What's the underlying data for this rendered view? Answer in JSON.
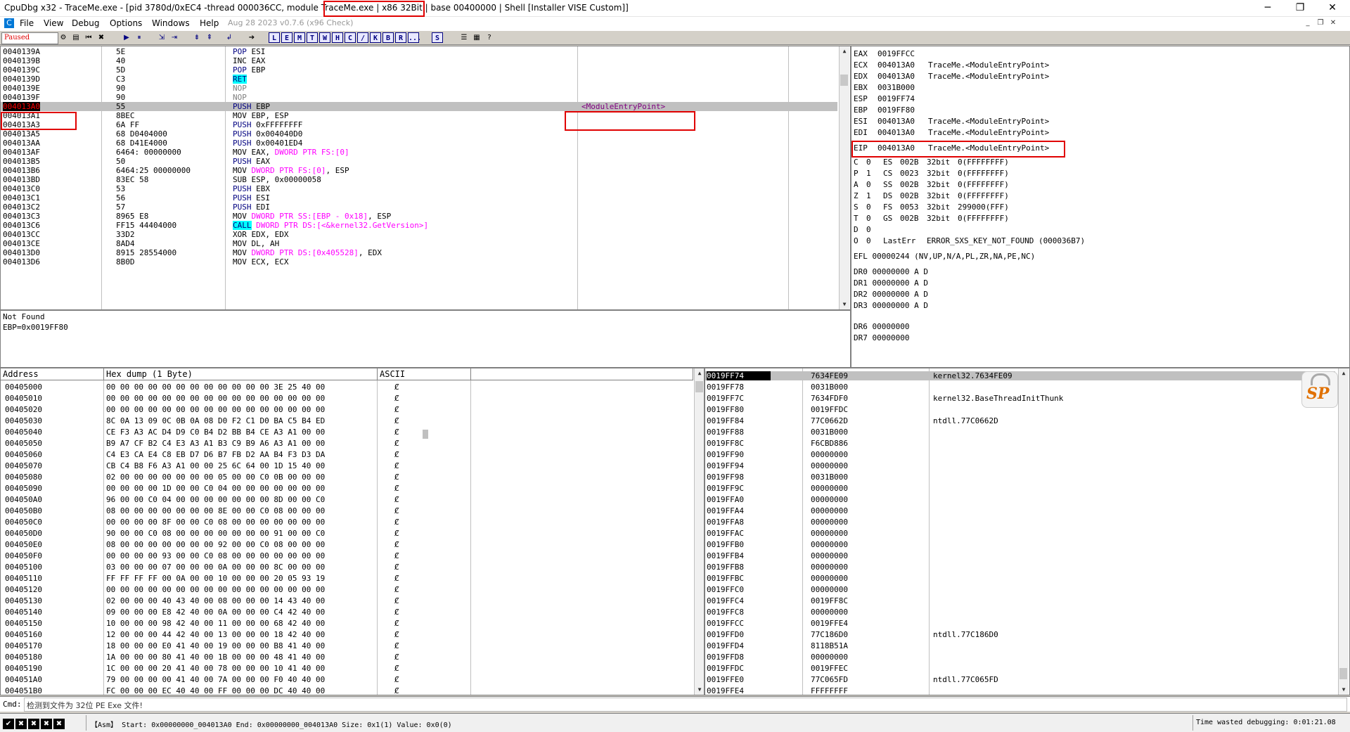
{
  "window": {
    "title": "CpuDbg x32 - TraceMe.exe - [pid 3780d/0xEC4 -thread 000036CC, module TraceMe.exe | x86 32Bit | base 00400000 | Shell [Installer VISE Custom]]",
    "minimize": "─",
    "maximize": "❐",
    "close": "✕"
  },
  "menu": {
    "items": [
      "File",
      "View",
      "Debug",
      "Options",
      "Windows",
      "Help"
    ],
    "build_info": "Aug 28 2023  v0.7.6 (x96 Check)"
  },
  "toolbar": {
    "state": "Paused",
    "letter_buttons": [
      "L",
      "E",
      "M",
      "T",
      "W",
      "H",
      "C",
      "/",
      "K",
      "B",
      "R",
      "...",
      "S"
    ]
  },
  "disasm": {
    "rows": [
      {
        "addr": "0040139A",
        "bytes": "5E",
        "op": "POP",
        "args": "ESI",
        "cls": "kw-push"
      },
      {
        "addr": "0040139B",
        "bytes": "40",
        "op": "INC",
        "args": "EAX",
        "cls": "kw"
      },
      {
        "addr": "0040139C",
        "bytes": "5D",
        "op": "POP",
        "args": "EBP",
        "cls": "kw-push"
      },
      {
        "addr": "0040139D",
        "bytes": "C3",
        "op": "RET",
        "args": "",
        "cls": "kw-ret"
      },
      {
        "addr": "0040139E",
        "bytes": "90",
        "op": "NOP",
        "args": "",
        "cls": "kw-nop"
      },
      {
        "addr": "0040139F",
        "bytes": "90",
        "op": "NOP",
        "args": "",
        "cls": "kw-nop"
      },
      {
        "addr": "004013A0",
        "bytes": "55",
        "op": "PUSH",
        "args": "EBP",
        "cls": "kw-push",
        "hl": true,
        "comment": "<ModuleEntryPoint>"
      },
      {
        "addr": "004013A1",
        "bytes": "8BEC",
        "op": "MOV",
        "args": "EBP,  ESP",
        "cls": "kw-mov"
      },
      {
        "addr": "004013A3",
        "bytes": "6A FF",
        "op": "PUSH",
        "args": "0xFFFFFFFF",
        "cls": "kw-push"
      },
      {
        "addr": "004013A5",
        "bytes": "68 D0404000",
        "op": "PUSH",
        "args": "0x004040D0",
        "cls": "kw-push"
      },
      {
        "addr": "004013AA",
        "bytes": "68 D41E4000",
        "op": "PUSH",
        "args": "0x00401ED4",
        "cls": "kw-push"
      },
      {
        "addr": "004013AF",
        "bytes": "6464: 00000000",
        "op": "MOV",
        "args": "EAX,  ",
        "mem": "DWORD PTR FS:[0]",
        "cls": "kw-mov"
      },
      {
        "addr": "004013B5",
        "bytes": "50",
        "op": "PUSH",
        "args": "EAX",
        "cls": "kw-push"
      },
      {
        "addr": "004013B6",
        "bytes": "6464:25 00000000",
        "op": "MOV",
        "args": "",
        "mem": "DWORD PTR FS:[0]",
        "tail": ",  ESP",
        "cls": "kw-mov"
      },
      {
        "addr": "004013BD",
        "bytes": "83EC 58",
        "op": "SUB",
        "args": "ESP,  0x00000058",
        "cls": "kw"
      },
      {
        "addr": "004013C0",
        "bytes": "53",
        "op": "PUSH",
        "args": "EBX",
        "cls": "kw-push"
      },
      {
        "addr": "004013C1",
        "bytes": "56",
        "op": "PUSH",
        "args": "ESI",
        "cls": "kw-push"
      },
      {
        "addr": "004013C2",
        "bytes": "57",
        "op": "PUSH",
        "args": "EDI",
        "cls": "kw-push"
      },
      {
        "addr": "004013C3",
        "bytes": "8965 E8",
        "op": "MOV",
        "args": "",
        "mem": "DWORD PTR SS:[EBP - 0x18]",
        "tail": ",  ESP",
        "cls": "kw-mov"
      },
      {
        "addr": "004013C6",
        "bytes": "FF15 44404000",
        "op": "CALL",
        "args": "",
        "mem": "DWORD PTR DS:[<&kernel32.GetVersion>]",
        "cls": "kw-call"
      },
      {
        "addr": "004013CC",
        "bytes": "33D2",
        "op": "XOR",
        "args": "EDX,  EDX",
        "cls": "kw"
      },
      {
        "addr": "004013CE",
        "bytes": "8AD4",
        "op": "MOV",
        "args": "DL,  AH",
        "cls": "kw-mov"
      },
      {
        "addr": "004013D0",
        "bytes": "8915 28554000",
        "op": "MOV",
        "args": "",
        "mem": "DWORD PTR DS:[0x405528]",
        "tail": ",  EDX",
        "cls": "kw-mov"
      },
      {
        "addr": "004013D6",
        "bytes": "8B0D",
        "op": "MOV",
        "args": "ECX,  ECX",
        "cls": "kw-mov"
      }
    ]
  },
  "info": {
    "lines": [
      "Not Found",
      "EBP=0x0019FF80"
    ]
  },
  "registers": {
    "gprs": [
      {
        "name": "EAX",
        "value": "0019FFCC",
        "note": ""
      },
      {
        "name": "ECX",
        "value": "004013A0",
        "note": "TraceMe.<ModuleEntryPoint>"
      },
      {
        "name": "EDX",
        "value": "004013A0",
        "note": "TraceMe.<ModuleEntryPoint>"
      },
      {
        "name": "EBX",
        "value": "0031B000",
        "note": ""
      },
      {
        "name": "ESP",
        "value": "0019FF74",
        "note": ""
      },
      {
        "name": "EBP",
        "value": "0019FF80",
        "note": ""
      },
      {
        "name": "ESI",
        "value": "004013A0",
        "note": "TraceMe.<ModuleEntryPoint>"
      },
      {
        "name": "EDI",
        "value": "004013A0",
        "note": "TraceMe.<ModuleEntryPoint>"
      }
    ],
    "eip": {
      "name": "EIP",
      "value": "004013A0",
      "note": "TraceMe.<ModuleEntryPoint>"
    },
    "flags": [
      {
        "f": "C",
        "v": "0",
        "seg": "ES",
        "sel": "002B",
        "bits": "32bit",
        "range": "0(FFFFFFFF)"
      },
      {
        "f": "P",
        "v": "1",
        "seg": "CS",
        "sel": "0023",
        "bits": "32bit",
        "range": "0(FFFFFFFF)"
      },
      {
        "f": "A",
        "v": "0",
        "seg": "SS",
        "sel": "002B",
        "bits": "32bit",
        "range": "0(FFFFFFFF)"
      },
      {
        "f": "Z",
        "v": "1",
        "seg": "DS",
        "sel": "002B",
        "bits": "32bit",
        "range": "0(FFFFFFFF)"
      },
      {
        "f": "S",
        "v": "0",
        "seg": "FS",
        "sel": "0053",
        "bits": "32bit",
        "range": "299000(FFF)"
      },
      {
        "f": "T",
        "v": "0",
        "seg": "GS",
        "sel": "002B",
        "bits": "32bit",
        "range": "0(FFFFFFFF)"
      },
      {
        "f": "D",
        "v": "0",
        "seg": "",
        "sel": "",
        "bits": "",
        "range": ""
      },
      {
        "f": "O",
        "v": "0",
        "seg": "LastErr",
        "sel": "ERROR_SXS_KEY_NOT_FOUND (000036B7)",
        "bits": "",
        "range": ""
      }
    ],
    "efl": "EFL  00000244 (NV,UP,N/A,PL,ZR,NA,PE,NC)",
    "dr": [
      "DR0  00000000 A D",
      "DR1  00000000 A D",
      "DR2  00000000 A D",
      "DR3  00000000 A D",
      "DR6  00000000",
      "DR7  00000000"
    ]
  },
  "dump": {
    "headers": [
      "Address",
      "Hex dump (1 Byte)",
      "ASCII"
    ],
    "rows": [
      {
        "addr": "00405000",
        "hex": "00 00 00 00 00 00 00 00 00 00 00 00 3E 25 40 00"
      },
      {
        "addr": "00405010",
        "hex": "00 00 00 00 00 00 00 00 00 00 00 00 00 00 00 00"
      },
      {
        "addr": "00405020",
        "hex": "00 00 00 00 00 00 00 00 00 00 00 00 00 00 00 00"
      },
      {
        "addr": "00405030",
        "hex": "8C 0A 13 09 0C 0B 0A 08 D0 F2 C1 D0 BA C5 B4 ED"
      },
      {
        "addr": "00405040",
        "hex": "CE F3 A3 AC D4 D9 C0 B4 D2 BB B4 CE A3 A1 00 00"
      },
      {
        "addr": "00405050",
        "hex": "B9 A7 CF B2 C4 E3 A3 A1 B3 C9 B9 A6 A3 A1 00 00"
      },
      {
        "addr": "00405060",
        "hex": "C4 E3 CA E4 C8 EB D7 D6 B7 FB D2 AA B4 F3 D3 DA"
      },
      {
        "addr": "00405070",
        "hex": "CB C4 B8 F6 A3 A1 00 00 25 6C 64 00 1D 15 40 00"
      },
      {
        "addr": "00405080",
        "hex": "02 00 00 00 00 00 00 00 05 00 00 C0 0B 00 00 00"
      },
      {
        "addr": "00405090",
        "hex": "00 00 00 00 1D 00 00 C0 04 00 00 00 00 00 00 00"
      },
      {
        "addr": "004050A0",
        "hex": "96 00 00 C0 04 00 00 00 00 00 00 00 8D 00 00 C0"
      },
      {
        "addr": "004050B0",
        "hex": "08 00 00 00 00 00 00 00 8E 00 00 C0 08 00 00 00"
      },
      {
        "addr": "004050C0",
        "hex": "00 00 00 00 8F 00 00 C0 08 00 00 00 00 00 00 00"
      },
      {
        "addr": "004050D0",
        "hex": "90 00 00 C0 08 00 00 00 00 00 00 00 91 00 00 C0"
      },
      {
        "addr": "004050E0",
        "hex": "08 00 00 00 00 00 00 00 92 00 00 C0 08 00 00 00"
      },
      {
        "addr": "004050F0",
        "hex": "00 00 00 00 93 00 00 C0 08 00 00 00 00 00 00 00"
      },
      {
        "addr": "00405100",
        "hex": "03 00 00 00 07 00 00 00 0A 00 00 00 8C 00 00 00"
      },
      {
        "addr": "00405110",
        "hex": "FF FF FF FF 00 0A 00 00 10 00 00 00 20 05 93 19"
      },
      {
        "addr": "00405120",
        "hex": "00 00 00 00 00 00 00 00 00 00 00 00 00 00 00 00"
      },
      {
        "addr": "00405130",
        "hex": "02 00 00 00 40 43 40 00 08 00 00 00 14 43 40 00"
      },
      {
        "addr": "00405140",
        "hex": "09 00 00 00 E8 42 40 00 0A 00 00 00 C4 42 40 00"
      },
      {
        "addr": "00405150",
        "hex": "10 00 00 00 98 42 40 00 11 00 00 00 68 42 40 00"
      },
      {
        "addr": "00405160",
        "hex": "12 00 00 00 44 42 40 00 13 00 00 00 18 42 40 00"
      },
      {
        "addr": "00405170",
        "hex": "18 00 00 00 E0 41 40 00 19 00 00 00 B8 41 40 00"
      },
      {
        "addr": "00405180",
        "hex": "1A 00 00 00 80 41 40 00 1B 00 00 00 48 41 40 00"
      },
      {
        "addr": "00405190",
        "hex": "1C 00 00 00 20 41 40 00 78 00 00 00 10 41 40 00"
      },
      {
        "addr": "004051A0",
        "hex": "79 00 00 00 00 41 40 00 7A 00 00 00 F0 40 40 00"
      },
      {
        "addr": "004051B0",
        "hex": "FC 00 00 00 EC 40 40 00 FF 00 00 00 DC 40 40 00"
      }
    ],
    "ascii_glyph": "Ȼ"
  },
  "stack": {
    "rows": [
      {
        "addr": "0019FF74",
        "val": "7634FE09",
        "cmt": "kernel32.7634FE09",
        "sel": true
      },
      {
        "addr": "0019FF78",
        "val": "0031B000",
        "cmt": ""
      },
      {
        "addr": "0019FF7C",
        "val": "7634FDF0",
        "cmt": "kernel32.BaseThreadInitThunk"
      },
      {
        "addr": "0019FF80",
        "val": "0019FFDC",
        "cmt": ""
      },
      {
        "addr": "0019FF84",
        "val": "77C0662D",
        "cmt": "ntdll.77C0662D"
      },
      {
        "addr": "0019FF88",
        "val": "0031B000",
        "cmt": ""
      },
      {
        "addr": "0019FF8C",
        "val": "F6CBD886",
        "cmt": ""
      },
      {
        "addr": "0019FF90",
        "val": "00000000",
        "cmt": ""
      },
      {
        "addr": "0019FF94",
        "val": "00000000",
        "cmt": ""
      },
      {
        "addr": "0019FF98",
        "val": "0031B000",
        "cmt": ""
      },
      {
        "addr": "0019FF9C",
        "val": "00000000",
        "cmt": ""
      },
      {
        "addr": "0019FFA0",
        "val": "00000000",
        "cmt": ""
      },
      {
        "addr": "0019FFA4",
        "val": "00000000",
        "cmt": ""
      },
      {
        "addr": "0019FFA8",
        "val": "00000000",
        "cmt": ""
      },
      {
        "addr": "0019FFAC",
        "val": "00000000",
        "cmt": ""
      },
      {
        "addr": "0019FFB0",
        "val": "00000000",
        "cmt": ""
      },
      {
        "addr": "0019FFB4",
        "val": "00000000",
        "cmt": ""
      },
      {
        "addr": "0019FFB8",
        "val": "00000000",
        "cmt": ""
      },
      {
        "addr": "0019FFBC",
        "val": "00000000",
        "cmt": ""
      },
      {
        "addr": "0019FFC0",
        "val": "00000000",
        "cmt": ""
      },
      {
        "addr": "0019FFC4",
        "val": "0019FF8C",
        "cmt": ""
      },
      {
        "addr": "0019FFC8",
        "val": "00000000",
        "cmt": ""
      },
      {
        "addr": "0019FFCC",
        "val": "0019FFE4",
        "cmt": ""
      },
      {
        "addr": "0019FFD0",
        "val": "77C186D0",
        "cmt": "ntdll.77C186D0"
      },
      {
        "addr": "0019FFD4",
        "val": "8118B51A",
        "cmt": ""
      },
      {
        "addr": "0019FFD8",
        "val": "00000000",
        "cmt": ""
      },
      {
        "addr": "0019FFDC",
        "val": "0019FFEC",
        "cmt": ""
      },
      {
        "addr": "0019FFE0",
        "val": "77C065FD",
        "cmt": "ntdll.77C065FD"
      },
      {
        "addr": "0019FFE4",
        "val": "FFFFFFFF",
        "cmt": ""
      }
    ],
    "logo": "SP"
  },
  "command": {
    "label": "Cmd:",
    "value": "检测到文件为 32位 PE Exe 文件!"
  },
  "status": {
    "asm": "【Asm】 Start: 0x00000000_004013A0 End: 0x00000000_004013A0 Size: 0x1(1) Value: 0x0(0)",
    "time": "Time wasted debugging: 0:01:21.08"
  },
  "colors": {
    "accent": "#e00000",
    "selection": "#000000",
    "highlight_row": "#c0c0c0"
  }
}
